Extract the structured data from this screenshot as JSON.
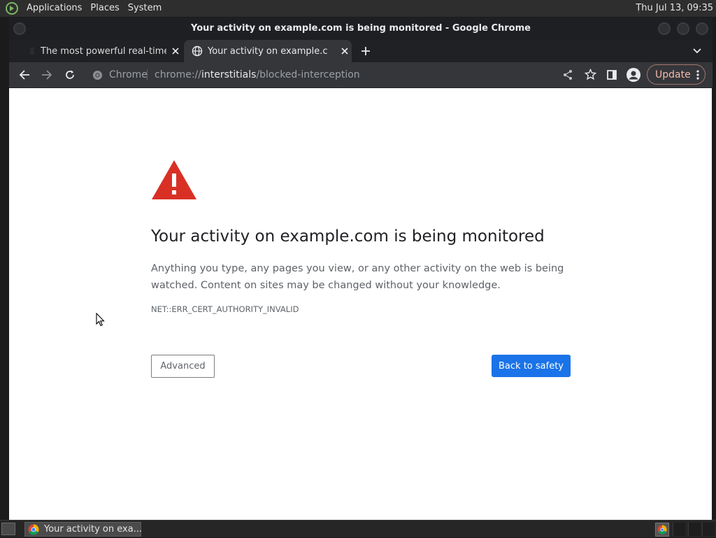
{
  "top_panel": {
    "menus": [
      "Applications",
      "Places",
      "System"
    ],
    "clock": "Thu Jul 13, 09:35"
  },
  "window": {
    "title": "Your activity on example.com is being monitored - Google Chrome"
  },
  "tabs": [
    {
      "title": "The most powerful real-time"
    },
    {
      "title": "Your activity on example.com"
    }
  ],
  "toolbar": {
    "site_chip": "Chrome",
    "url_scheme": "chrome://",
    "url_host": "interstitials",
    "url_path": "/blocked-interception",
    "update_label": "Update"
  },
  "page": {
    "heading": "Your activity on example.com is being monitored",
    "body": "Anything you type, any pages you view, or any other activity on the web is being watched. Content on sites may be changed without your knowledge.",
    "error_code": "NET::ERR_CERT_AUTHORITY_INVALID",
    "advanced_label": "Advanced",
    "safety_label": "Back to safety"
  },
  "taskbar": {
    "task_label": "Your activity on exa..."
  },
  "colors": {
    "warning_red": "#d93025",
    "primary_blue": "#1a73e8",
    "update_outline": "#a0766d"
  },
  "icons": [
    "distro-logo-icon",
    "close-icon",
    "plus-icon",
    "chevron-down-icon",
    "back-arrow-icon",
    "forward-arrow-icon",
    "reload-icon",
    "chrome-icon",
    "share-icon",
    "star-icon",
    "side-panel-icon",
    "profile-icon",
    "more-vert-icon",
    "warning-triangle-icon",
    "mouse-cursor-icon"
  ]
}
